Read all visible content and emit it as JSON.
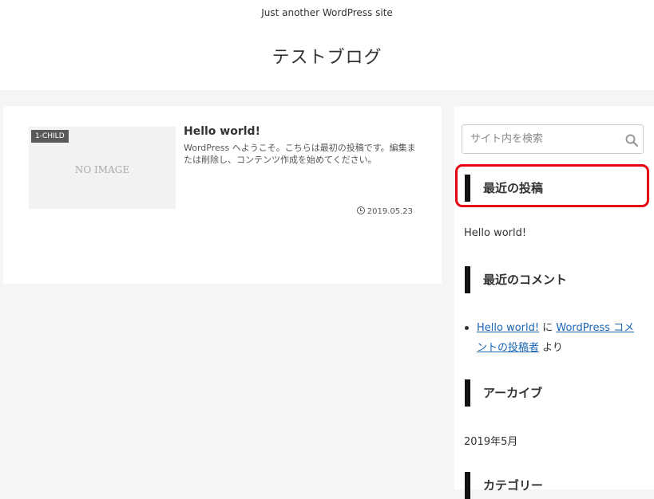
{
  "header": {
    "tagline": "Just another WordPress site",
    "site_title": "テストブログ"
  },
  "post": {
    "category": "1-CHILD",
    "thumbnail_text": "NO IMAGE",
    "title": "Hello world!",
    "excerpt": "WordPress へようこそ。こちらは最初の投稿です。編集または削除し、コンテンツ作成を始めてください。",
    "date": "2019.05.23"
  },
  "sidebar": {
    "search_placeholder": "サイト内を検索",
    "recent_posts_title": "最近の投稿",
    "recent_post_item": "Hello world!",
    "recent_comments_title": "最近のコメント",
    "comment": {
      "post_link": "Hello world!",
      "connector": " に ",
      "author_link": "WordPress コメントの投稿者",
      "suffix": " より"
    },
    "archives_title": "アーカイブ",
    "archive_item": "2019年5月",
    "categories_title": "カテゴリー"
  },
  "colors": {
    "highlight": "#e60012",
    "link": "#1a66b3"
  }
}
